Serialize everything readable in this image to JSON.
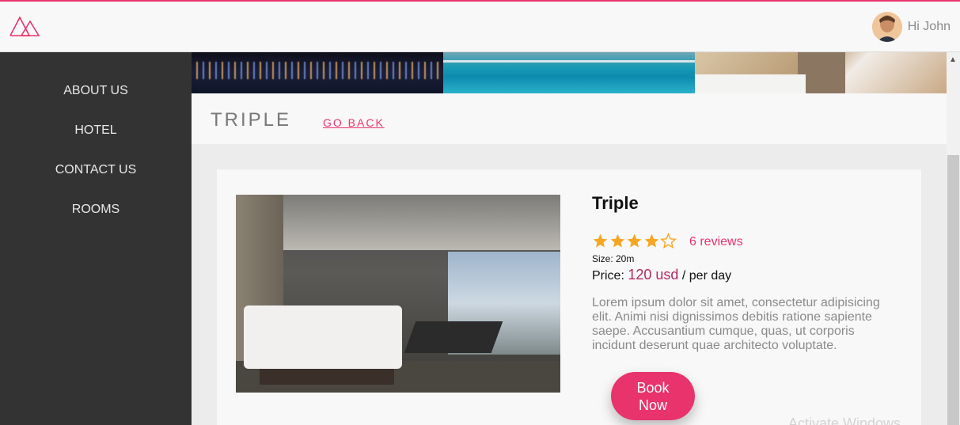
{
  "header": {
    "logo_icon": "mountain-logo-icon",
    "accent_color": "#e8336c",
    "user_greeting": "Hi John"
  },
  "sidebar": {
    "items": [
      {
        "label": "ABOUT US"
      },
      {
        "label": "HOTEL"
      },
      {
        "label": "CONTACT US"
      },
      {
        "label": "ROOMS"
      }
    ]
  },
  "page": {
    "title": "TRIPLE",
    "go_back": "GO BACK"
  },
  "room": {
    "name": "Triple",
    "rating": 4,
    "rating_max": 5,
    "reviews": "6 reviews",
    "size": "Size: 20m",
    "price_label": "Price:",
    "price_amount": "120 usd",
    "price_period": "/ per day",
    "description": "Lorem ipsum dolor sit amet, consectetur adipisicing elit. Animi nisi dignissimos debitis ratione sapiente saepe. Accusantium cumque, quas, ut corporis incidunt deserunt quae architecto voluptate.",
    "book_button": "Book Now"
  },
  "watermark": "Activate Windows"
}
